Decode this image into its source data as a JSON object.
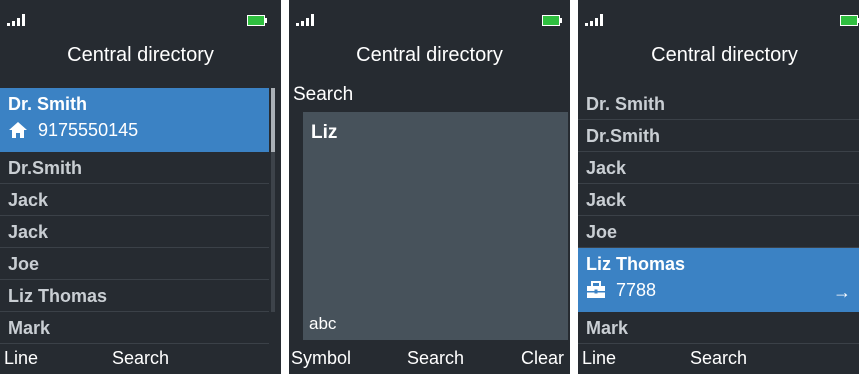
{
  "screens": {
    "directory": {
      "title": "Central directory",
      "selected": {
        "name": "Dr. Smith",
        "icon": "home-icon",
        "number": "9175550145"
      },
      "items": [
        "Dr.Smith",
        "Jack",
        "Jack",
        "Joe",
        "Liz Thomas",
        "Mark"
      ],
      "softkeys": {
        "left": "Line",
        "middle": "Search"
      }
    },
    "search": {
      "title": "Central directory",
      "label": "Search",
      "value": "Liz",
      "input_mode": "abc",
      "softkeys": {
        "left": "Symbol",
        "middle": "Search",
        "right": "Clear"
      }
    },
    "result": {
      "title": "Central directory",
      "items_before": [
        "Dr. Smith",
        "Dr.Smith",
        "Jack",
        "Jack",
        "Joe"
      ],
      "selected": {
        "name": "Liz Thomas",
        "icon": "briefcase-icon",
        "number": "7788",
        "arrow": "→"
      },
      "items_after": [
        "Mark"
      ],
      "softkeys": {
        "left": "Line",
        "middle": "Search"
      }
    }
  },
  "colors": {
    "background": "#262b31",
    "highlight": "#3b82c4",
    "search_box": "#47525b",
    "battery": "#2fbf3f",
    "list_text": "#c9ced3"
  }
}
